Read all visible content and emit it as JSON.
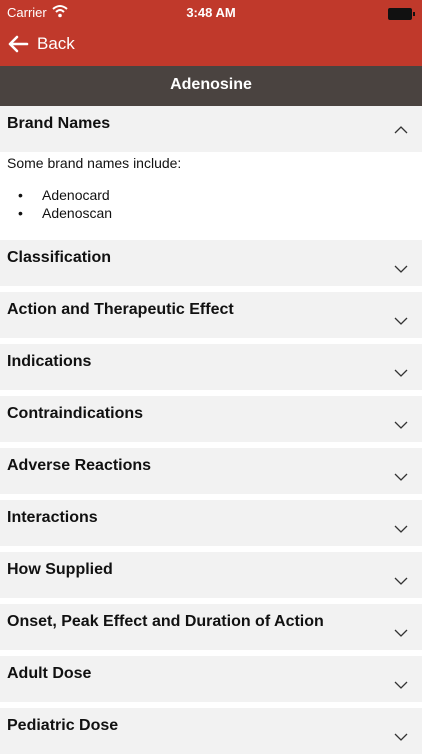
{
  "status": {
    "carrier": "Carrier",
    "time": "3:48 AM"
  },
  "nav": {
    "back_label": "Back"
  },
  "page": {
    "title": "Adenosine"
  },
  "brand_section": {
    "title": "Brand Names",
    "intro": "Some brand names include:",
    "items": [
      "Adenocard",
      "Adenoscan"
    ]
  },
  "sections": [
    {
      "title": "Classification"
    },
    {
      "title": "Action and Therapeutic Effect"
    },
    {
      "title": "Indications"
    },
    {
      "title": "Contraindications"
    },
    {
      "title": "Adverse Reactions"
    },
    {
      "title": "Interactions"
    },
    {
      "title": "How Supplied"
    },
    {
      "title": "Onset, Peak Effect and Duration of Action"
    },
    {
      "title": "Adult Dose"
    },
    {
      "title": "Pediatric Dose"
    }
  ],
  "colors": {
    "accent": "#c0392b",
    "title_bar": "#4a4340",
    "section_bg": "#f2f2f2"
  }
}
